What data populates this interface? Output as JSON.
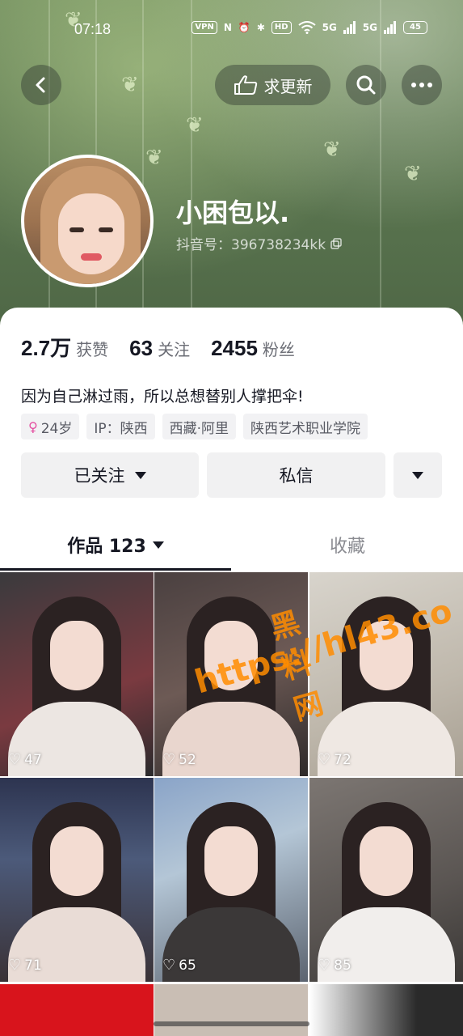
{
  "status_bar": {
    "time": "07:18",
    "vpn": "VPN",
    "hd": "HD",
    "net1": "5G",
    "net2": "5G",
    "battery": "45"
  },
  "header": {
    "back_icon": "chevron-left-icon",
    "update_label": "求更新",
    "search_icon": "search-icon",
    "more_icon": "more-dots-icon"
  },
  "profile": {
    "nickname": "小困包以.",
    "douyin_id": "抖音号：396738234kk",
    "copy_icon": "copy-icon"
  },
  "stats": [
    {
      "num": "2.7万",
      "label": "获赞"
    },
    {
      "num": "63",
      "label": "关注"
    },
    {
      "num": "2455",
      "label": "粉丝"
    }
  ],
  "bio": "因为自己淋过雨，所以总想替别人撑把伞!",
  "tags": [
    {
      "text": "24岁",
      "icon": "female-icon"
    },
    {
      "text": "IP：陕西"
    },
    {
      "text": "西藏·阿里"
    },
    {
      "text": "陕西艺术职业学院"
    }
  ],
  "actions": {
    "follow_label": "已关注",
    "message_label": "私信"
  },
  "tabs": {
    "works_label": "作品 123",
    "favorites_label": "收藏"
  },
  "posts": [
    {
      "likes": "47"
    },
    {
      "likes": "52"
    },
    {
      "likes": "72"
    },
    {
      "likes": "71"
    },
    {
      "likes": "65"
    },
    {
      "likes": "85"
    }
  ],
  "watermark": {
    "title": "黑料网",
    "url": "https://hl43.co"
  },
  "colors": {
    "accent_female": "#e44ea0",
    "watermark": "#ff8c00",
    "banner_green": "#5f7a52"
  }
}
